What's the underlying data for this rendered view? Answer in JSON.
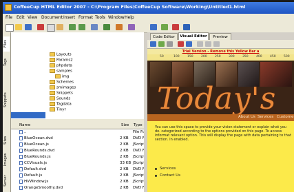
{
  "window": {
    "title": "CoffeeCup HTML Editor 2007 - C:\\Program Files\\CoffeeCup Software\\Working\\Untitled1.html"
  },
  "menu": [
    "File",
    "Edit",
    "View",
    "Document",
    "Insert",
    "Format",
    "Tools",
    "Window",
    "Help"
  ],
  "editor_tabs": [
    {
      "label": "Code Editor",
      "active": false
    },
    {
      "label": "Visual Editor",
      "active": true
    },
    {
      "label": "Preview",
      "active": false
    }
  ],
  "side_tabs": [
    "Files",
    "Tags",
    "Snippets",
    "Sites",
    "Images",
    "Server"
  ],
  "folder_tree": [
    "Layouts",
    "Params2",
    "phpdata",
    "samples",
    "img",
    "Schemes",
    "smimages",
    "Snippets",
    "Sounds",
    "Tagdata",
    "Tinyr"
  ],
  "file_list": {
    "columns": [
      "Name",
      "Size",
      "Type"
    ],
    "rows": [
      {
        "name": "..",
        "size": "",
        "type": "File Fo"
      },
      {
        "name": "BlueOcean.dvd",
        "size": "2 KB",
        "type": "DVD F"
      },
      {
        "name": "BlueOcean.js",
        "size": "2 KB",
        "type": "JScript"
      },
      {
        "name": "BlueRounds.dvd",
        "size": "2 KB",
        "type": "DVD F"
      },
      {
        "name": "BlueRounds.js",
        "size": "2 KB",
        "type": "JScript"
      },
      {
        "name": "CCVisuals.js",
        "size": "33 KB",
        "type": "JScript"
      },
      {
        "name": "Default.dvd",
        "size": "2 KB",
        "type": "DVD F"
      },
      {
        "name": "Default.js",
        "size": "2 KB",
        "type": "JScript"
      },
      {
        "name": "HVWindow.js",
        "size": "2 KB",
        "type": "JScript"
      },
      {
        "name": "OrangeSmoothy.dvd",
        "size": "2 KB",
        "type": "DVD F"
      }
    ]
  },
  "trial_notice": "Trial Version - Remove this Yellow Bar a",
  "ruler_marks": [
    "50",
    "100",
    "150",
    "200",
    "250",
    "300",
    "350",
    "400",
    "450",
    "500"
  ],
  "banner": {
    "title": "Today's",
    "nav": [
      "About Us",
      "Services",
      "Custome"
    ]
  },
  "page": {
    "paragraph": "You can use this space to provide your vision statement or explain what you do. categorized according to the options provided on this page. To access informat relevant option. This will display the page with data pertaining to that section. In enabled.",
    "links": [
      "Services",
      "Contact Us"
    ]
  },
  "colors": {
    "title_bar": "#1f55c3",
    "content_bg": "#fcea4a",
    "banner_text": "#e9893a"
  }
}
